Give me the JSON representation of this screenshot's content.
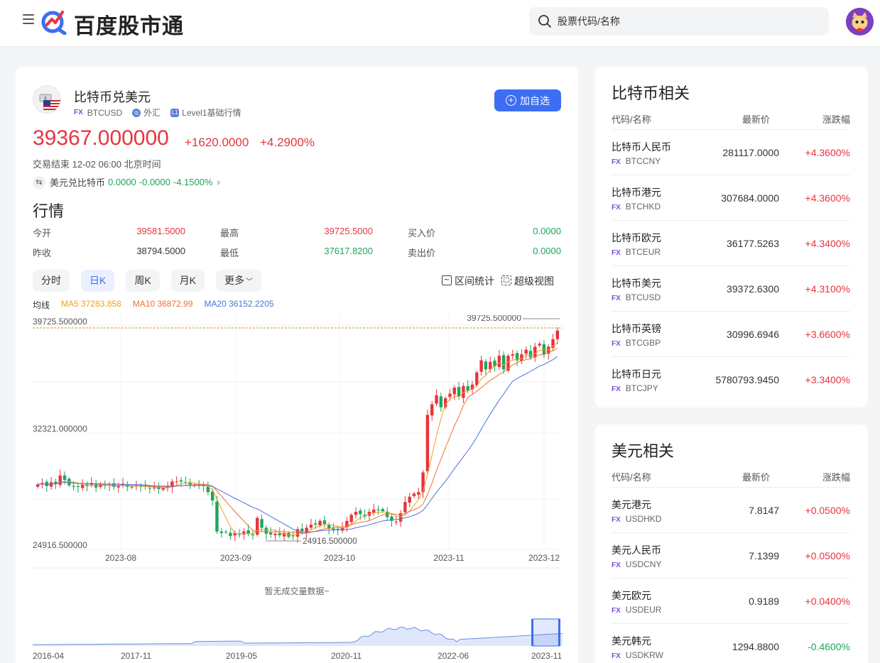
{
  "header": {
    "logo_text": "百度股市通",
    "search_placeholder": "股票代码/名称"
  },
  "stock": {
    "name": "比特币兑美元",
    "fx_badge": "FX",
    "code": "BTCUSD",
    "market": "外汇",
    "level_badge": "L1",
    "level": "Level1基础行情",
    "add_button": "加自选",
    "price": "39367.000000",
    "change": "+1620.0000",
    "change_pct": "+4.2900%",
    "status": "交易结束 12-02 06:00 北京时间",
    "reverse_name": "美元兑比特币",
    "reverse_price": "0.0000",
    "reverse_change": "-0.0000",
    "reverse_pct": "-4.1500%"
  },
  "quote": {
    "heading": "行情",
    "open_label": "今开",
    "open": "39581.5000",
    "high_label": "最高",
    "high": "39725.5000",
    "bid_label": "买入价",
    "bid": "0.0000",
    "prev_label": "昨收",
    "prev": "38794.5000",
    "low_label": "最低",
    "low": "37617.8200",
    "ask_label": "卖出价",
    "ask": "0.0000"
  },
  "tabs": [
    "分时",
    "日K",
    "周K",
    "月K",
    "更多"
  ],
  "active_tab": "日K",
  "tools": {
    "range_stats": "区间统计",
    "super_view": "超级视图"
  },
  "ma": {
    "label": "均线",
    "ma5": "MA5 37283.858",
    "ma10": "MA10 36872.99",
    "ma20": "MA20 36152.2205",
    "ma5_color": "#f0a020",
    "ma10_color": "#f07030",
    "ma20_color": "#4a74d8"
  },
  "chart_data": {
    "type": "candlestick",
    "y_axis_labels": [
      "39725.500000",
      "32321.000000",
      "24916.500000"
    ],
    "max_marker": "39725.500000",
    "min_marker": "24916.500000",
    "x_ticks": [
      "2023-08",
      "2023-09",
      "2023-10",
      "2023-11",
      "2023-12"
    ],
    "ylim": [
      24916.5,
      39725.5
    ],
    "up_color": "#e9333f",
    "down_color": "#1ea55e",
    "closes": [
      29200,
      29300,
      29100,
      29350,
      29250,
      29800,
      29500,
      29150,
      29050,
      29050,
      29200,
      29100,
      29300,
      29000,
      29250,
      29150,
      29200,
      29050,
      29100,
      29250,
      29050,
      29000,
      29150,
      29100,
      29050,
      28950,
      29000,
      28900,
      28950,
      29100,
      29400,
      29400,
      29400,
      29300,
      29200,
      29200,
      29150,
      29100,
      28700,
      28150,
      26100,
      26000,
      26050,
      25800,
      26000,
      25900,
      26100,
      25950,
      25850,
      27000,
      26350,
      25950,
      25900,
      25950,
      25850,
      26000,
      25750,
      25800,
      26250,
      26100,
      26350,
      26550,
      26550,
      26800,
      26600,
      26300,
      26200,
      26200,
      26350,
      26800,
      27200,
      27400,
      27250,
      27100,
      27400,
      27550,
      27500,
      27450,
      27050,
      26800,
      26750,
      27300,
      28050,
      28400,
      28600,
      28700,
      30000,
      33800,
      34500,
      35100,
      34300,
      34900,
      35200,
      35600,
      35000,
      35700,
      35400,
      35800,
      36600,
      37400,
      36800,
      37300,
      37000,
      37700,
      36800,
      37700,
      37800,
      37400,
      37800,
      38100,
      37600,
      38300,
      38500,
      37800,
      38300,
      38800,
      39367
    ],
    "note": "暂无成交量数据~"
  },
  "mini_chart": {
    "x_ticks": [
      "2016-04",
      "2017-11",
      "2019-05",
      "2020-11",
      "2022-06",
      "2023-11"
    ]
  },
  "btc_related": {
    "title": "比特币相关",
    "col_name": "代码/名称",
    "col_price": "最新价",
    "col_change": "涨跌幅",
    "items": [
      {
        "name": "比特币人民币",
        "code": "BTCCNY",
        "price": "281117.0000",
        "change": "+4.3600%"
      },
      {
        "name": "比特币港元",
        "code": "BTCHKD",
        "price": "307684.0000",
        "change": "+4.3600%"
      },
      {
        "name": "比特币欧元",
        "code": "BTCEUR",
        "price": "36177.5263",
        "change": "+4.3400%"
      },
      {
        "name": "比特币美元",
        "code": "BTCUSD",
        "price": "39372.6300",
        "change": "+4.3100%"
      },
      {
        "name": "比特币英镑",
        "code": "BTCGBP",
        "price": "30996.6946",
        "change": "+3.6600%"
      },
      {
        "name": "比特币日元",
        "code": "BTCJPY",
        "price": "5780793.9450",
        "change": "+3.3400%"
      }
    ]
  },
  "usd_related": {
    "title": "美元相关",
    "col_name": "代码/名称",
    "col_price": "最新价",
    "col_change": "涨跌幅",
    "items": [
      {
        "name": "美元港元",
        "code": "USDHKD",
        "price": "7.8147",
        "change": "+0.0500%"
      },
      {
        "name": "美元人民币",
        "code": "USDCNY",
        "price": "7.1399",
        "change": "+0.0500%"
      },
      {
        "name": "美元欧元",
        "code": "USDEUR",
        "price": "0.9189",
        "change": "+0.0400%"
      },
      {
        "name": "美元韩元",
        "code": "USDKRW",
        "price": "1294.8800",
        "change": "-0.4600%"
      }
    ]
  }
}
